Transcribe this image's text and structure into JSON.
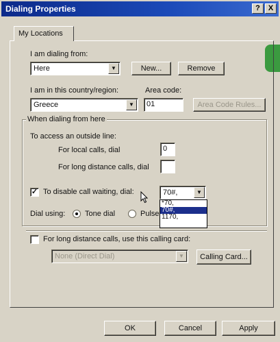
{
  "window": {
    "title": "Dialing Properties",
    "help_btn": "?",
    "close_btn": "X"
  },
  "tabs": [
    {
      "label": "My Locations",
      "active": true
    }
  ],
  "location": {
    "dialing_from_label": "I am dialing from:",
    "dialing_from_value": "Here",
    "new_btn": "New...",
    "remove_btn": "Remove",
    "country_label": "I am in this country/region:",
    "country_value": "Greece",
    "area_code_label": "Area code:",
    "area_code_value": "01",
    "area_code_rules_btn": "Area Code Rules..."
  },
  "dialing": {
    "group_title": "When dialing from here",
    "outside_line_label": "To access an outside line:",
    "local_label": "For local calls, dial",
    "local_value": "0",
    "long_distance_label": "For long distance calls, dial",
    "long_distance_value": "",
    "call_waiting_checked": true,
    "call_waiting_label": "To disable call waiting, dial:",
    "call_waiting_value": "70#,",
    "call_waiting_options": [
      "*70,",
      "70#,",
      "1170,"
    ],
    "call_waiting_selected_index": 1,
    "dial_using_label": "Dial using:",
    "tone_label": "Tone dial",
    "pulse_label": "Pulse",
    "dial_mode": "tone"
  },
  "calling_card": {
    "checked": false,
    "label": "For long distance calls, use this calling card:",
    "value": "None (Direct Dial)",
    "btn": "Calling Card..."
  },
  "footer": {
    "ok": "OK",
    "cancel": "Cancel",
    "apply": "Apply"
  },
  "colors": {
    "titlebar": "#0c2a8a",
    "dialog_bg": "#d8d3c6",
    "selection": "#1c2f8c",
    "green_tab": "#3b9a40"
  }
}
